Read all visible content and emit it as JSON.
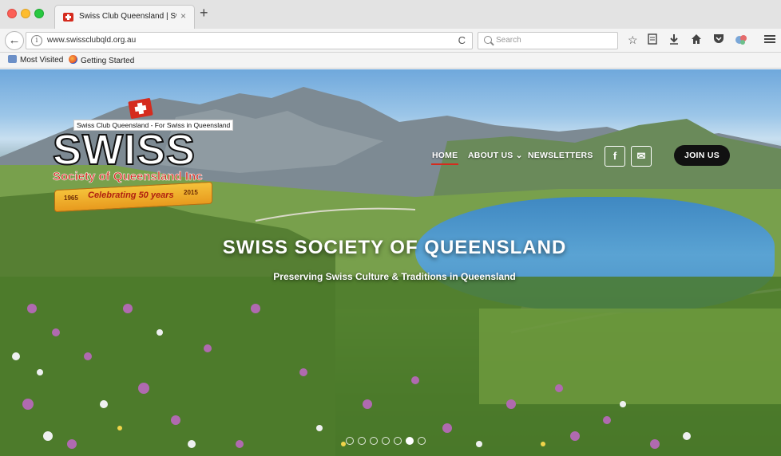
{
  "browser": {
    "tab_title": "Swiss Club Queensland | Swi",
    "tab_close": "×",
    "new_tab": "+",
    "back": "←",
    "info": "i",
    "url": "www.swissclubqld.org.au",
    "reload": "C",
    "search_placeholder": "Search",
    "toolbar_icons": [
      "star-icon",
      "reader-icon",
      "download-icon",
      "home-icon",
      "pocket-icon",
      "extension-icon",
      "menu-icon"
    ],
    "bookmarks": [
      "Most Visited",
      "Getting Started"
    ]
  },
  "logo": {
    "tagline": "Swiss Club Queensland - For Swiss in Queensland",
    "word": "SWISS",
    "subtitle": "Society of Queensland Inc",
    "ribbon_text": "Celebrating 50 years",
    "year_start": "1965",
    "year_end": "2015"
  },
  "nav": {
    "home": "HOME",
    "about": "ABOUT US",
    "about_caret": "⌄",
    "newsletters": "NEWSLETTERS",
    "facebook": "f",
    "email": "✉",
    "join": "JOIN US"
  },
  "hero": {
    "title": "SWISS SOCIETY OF QUEENSLAND",
    "subtitle": "Preserving Swiss Culture & Traditions in Queensland",
    "slides_total": 7,
    "active_slide": 6
  },
  "colors": {
    "swiss_red": "#d52b1e",
    "join_bg": "#111111"
  }
}
